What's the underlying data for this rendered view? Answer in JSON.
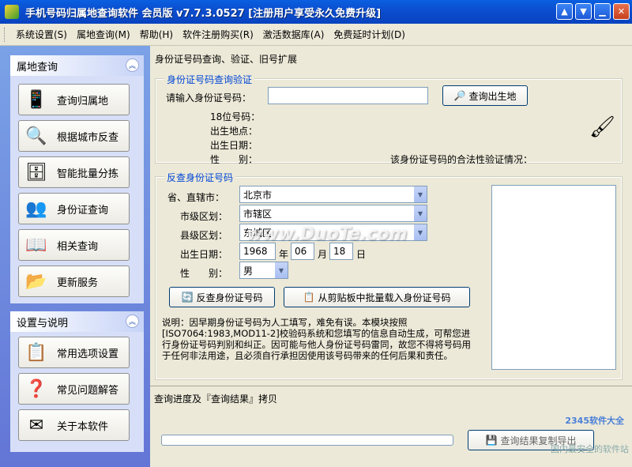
{
  "window": {
    "title": "手机号码归属地查询软件 会员版 v7.7.3.0527 [注册用户享受永久免费升级]"
  },
  "menu": [
    "系统设置(S)",
    "属地查询(M)",
    "帮助(H)",
    "软件注册购买(R)",
    "激活数据库(A)",
    "免费延时计划(D)"
  ],
  "leftnav": {
    "group1_title": "属地查询",
    "group1_items": [
      {
        "label": "查询归属地",
        "icon": "phone-icon"
      },
      {
        "label": "根据城市反查",
        "icon": "magnifier-icon"
      },
      {
        "label": "智能批量分拣",
        "icon": "database-icon"
      },
      {
        "label": "身份证查询",
        "icon": "users-icon"
      },
      {
        "label": "相关查询",
        "icon": "book-icon"
      },
      {
        "label": "更新服务",
        "icon": "folder-update-icon"
      }
    ],
    "group2_title": "设置与说明",
    "group2_items": [
      {
        "label": "常用选项设置",
        "icon": "settings-icon"
      },
      {
        "label": "常见问题解答",
        "icon": "help-icon"
      },
      {
        "label": "关于本软件",
        "icon": "mail-icon"
      }
    ]
  },
  "main": {
    "title": "身份证号码查询、验证、旧号扩展",
    "lookup": {
      "legend": "身份证号码查询验证",
      "prompt": "请输入身份证号码：",
      "input_value": "",
      "query_button": "查询出生地",
      "field_18": "18位号码：",
      "field_place": "出生地点：",
      "field_date": "出生日期：",
      "field_gender": "性　　别：",
      "validity_label": "该身份证号码的合法性验证情况："
    },
    "reverse": {
      "legend": "反查身份证号码",
      "province_label": "省、直辖市：",
      "province_value": "北京市",
      "city_label": "市级区划：",
      "city_value": "市辖区",
      "county_label": "县级区划：",
      "county_value": "东城区",
      "birth_label": "出生日期：",
      "year": "1968",
      "year_unit": "年",
      "month": "06",
      "month_unit": "月",
      "day": "18",
      "day_unit": "日",
      "gender_label": "性　　别：",
      "gender_value": "男",
      "reverse_button": "反查身份证号码",
      "batch_button": "从剪贴板中批量载入身份证号码"
    },
    "note": "说明：因早期身份证号码为人工填写，难免有误。本模块按照[ISO7064:1983,MOD11-2]校验码系统和您填写的信息自动生成，可帮您进行身份证号码判别和纠正。因可能与他人身份证号码雷同，故您不得将号码用于任何非法用途，且必须自行承担因使用该号码带来的任何后果和责任。",
    "bottom_title": "查询进度及『查询结果』拷贝",
    "copy_button": "查询结果复制导出",
    "progress": 0
  },
  "watermarks": {
    "center": "www.DuoTe.com",
    "logo": "2345软件大全",
    "footer": "国内最安全的软件站"
  }
}
